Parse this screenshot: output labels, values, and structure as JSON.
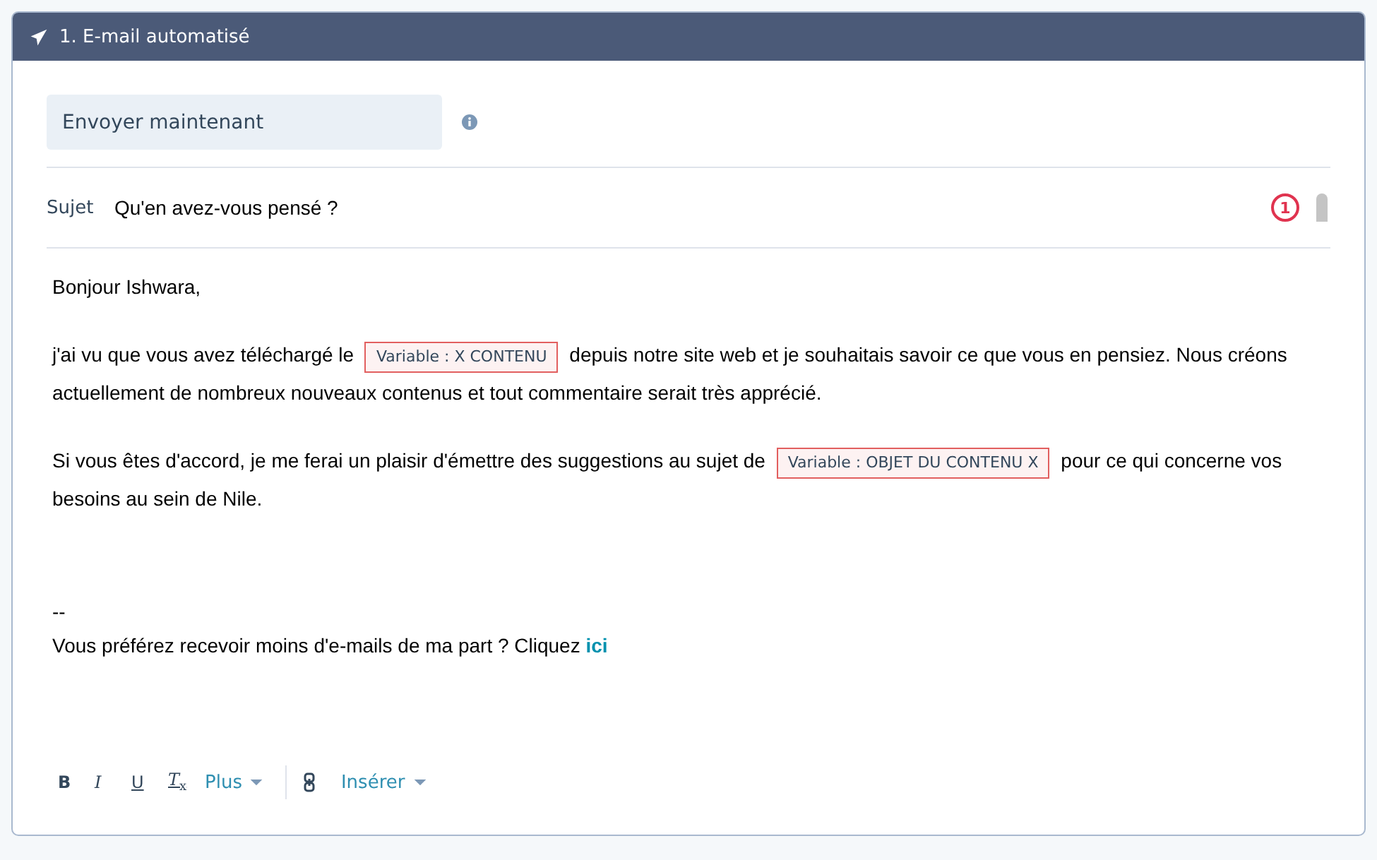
{
  "header": {
    "title": "1. E-mail automatisé"
  },
  "send_field": {
    "value": "Envoyer maintenant"
  },
  "subject": {
    "label": "Sujet",
    "value": "Qu'en avez-vous pensé ?",
    "error_count": "1"
  },
  "body": [
    {
      "lines": [
        [
          {
            "kind": "text",
            "text": "Bonjour Ishwara,"
          }
        ]
      ]
    },
    {
      "lines": [
        [
          {
            "kind": "text",
            "text": "j'ai vu que vous avez téléchargé le"
          },
          {
            "kind": "variable",
            "text": "Variable : X CONTENU"
          },
          {
            "kind": "text",
            "text": "depuis notre site web et je souhaitais savoir ce que vous en pensiez. Nous créons"
          }
        ],
        [
          {
            "kind": "text",
            "text": "actuellement de nombreux nouveaux contenus et tout commentaire serait très apprécié."
          }
        ]
      ]
    },
    {
      "lines": [
        [
          {
            "kind": "text",
            "text": "Si vous êtes d'accord, je me ferai un plaisir d'émettre des suggestions au sujet de"
          },
          {
            "kind": "variable",
            "text": "Variable : OBJET DU CONTENU X"
          },
          {
            "kind": "text",
            "text": "pour ce qui concerne vos"
          }
        ],
        [
          {
            "kind": "text",
            "text": "besoins au sein de Nile."
          }
        ]
      ]
    },
    {
      "lines": [
        [
          {
            "kind": "text",
            "text": "--"
          }
        ],
        [
          {
            "kind": "text",
            "text": "Vous préférez recevoir moins d'e-mails de ma part ? Cliquez"
          },
          {
            "kind": "link",
            "text": "ici"
          }
        ]
      ]
    }
  ],
  "toolbar": [
    {
      "kind": "bold",
      "text": "B"
    },
    {
      "kind": "italic",
      "text": "I"
    },
    {
      "kind": "underline",
      "text": "U"
    },
    {
      "kind": "clear",
      "text": "T$_{x}$"
    },
    {
      "kind": "menu",
      "text": "Plus"
    },
    {
      "kind": "divider"
    },
    {
      "kind": "link"
    },
    {
      "kind": "menu",
      "text": "Insérer"
    }
  ]
}
